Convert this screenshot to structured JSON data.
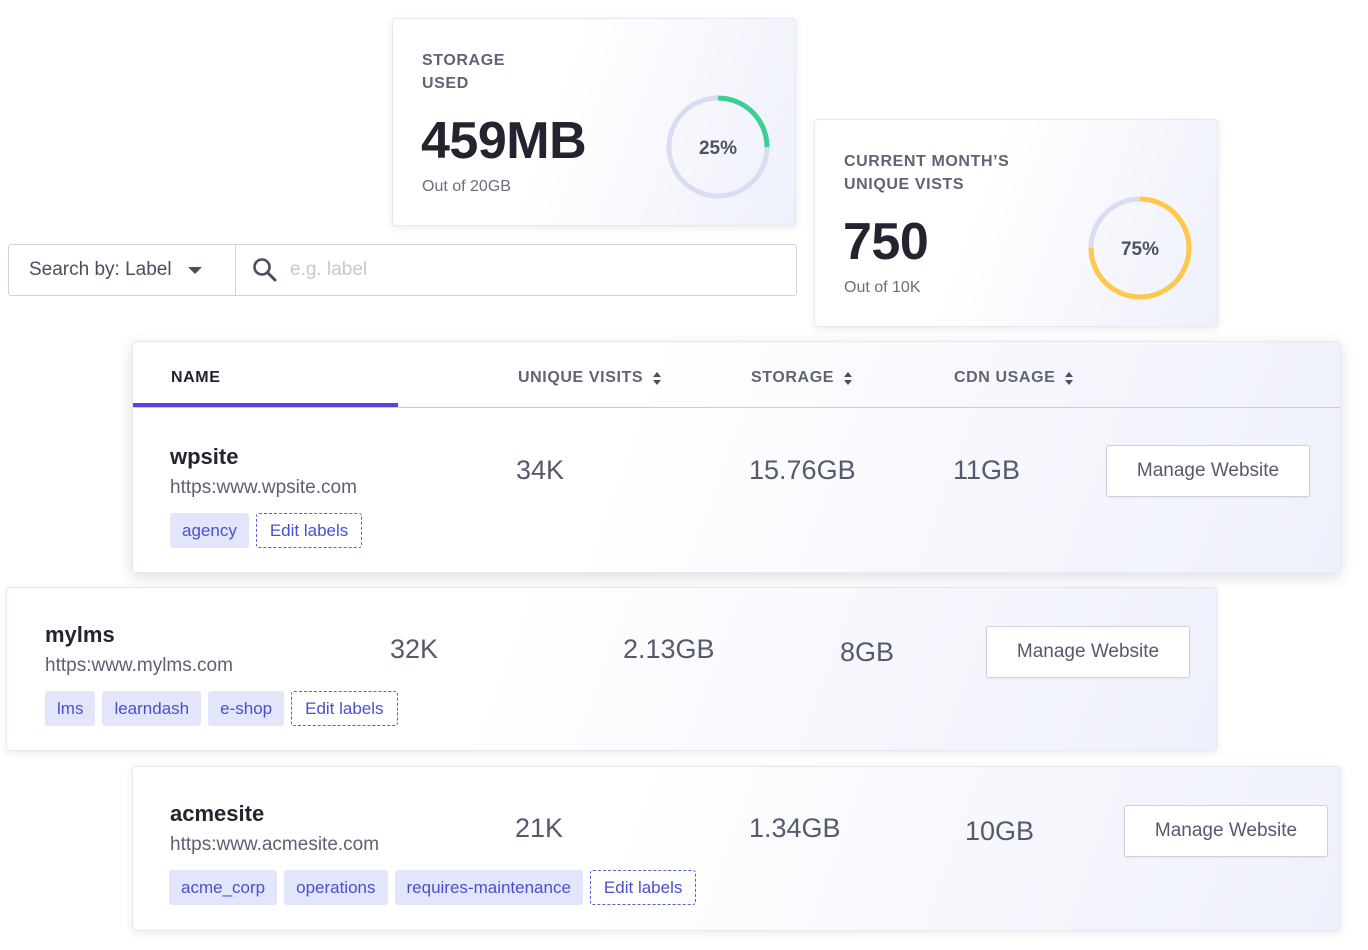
{
  "storage": {
    "label": "STORAGE\nUSED",
    "value": "459MB",
    "sub": "Out of 20GB",
    "percent": 25,
    "percent_label": "25%",
    "color": "#3ccf91"
  },
  "visits": {
    "label": "CURRENT MONTH’S\nUNIQUE VISTS",
    "value": "750",
    "sub": "Out of 10K",
    "percent": 75,
    "percent_label": "75%",
    "color": "#fec84b"
  },
  "ring_track_color": "#d9dcf3",
  "search": {
    "select_label": "Search by: Label",
    "placeholder": "e.g. label"
  },
  "table": {
    "columns": {
      "name": "NAME",
      "visits": "UNIQUE VISITS",
      "storage": "STORAGE",
      "cdn": "CDN USAGE"
    },
    "accent": "#5b3fe0"
  },
  "rows": [
    {
      "name": "wpsite",
      "url": "https:www.wpsite.com",
      "visits": "34K",
      "storage": "15.76GB",
      "cdn": "11GB",
      "labels": [
        "agency"
      ],
      "edit_label": "Edit labels",
      "action": "Manage Website"
    },
    {
      "name": "mylms",
      "url": "https:www.mylms.com",
      "visits": "32K",
      "storage": "2.13GB",
      "cdn": "8GB",
      "labels": [
        "lms",
        "learndash",
        "e-shop"
      ],
      "edit_label": "Edit labels",
      "action": "Manage Website"
    },
    {
      "name": "acmesite",
      "url": "https:www.acmesite.com",
      "visits": "21K",
      "storage": "1.34GB",
      "cdn": "10GB",
      "labels": [
        "acme_corp",
        "operations",
        "requires-maintenance"
      ],
      "edit_label": "Edit labels",
      "action": "Manage Website"
    }
  ]
}
